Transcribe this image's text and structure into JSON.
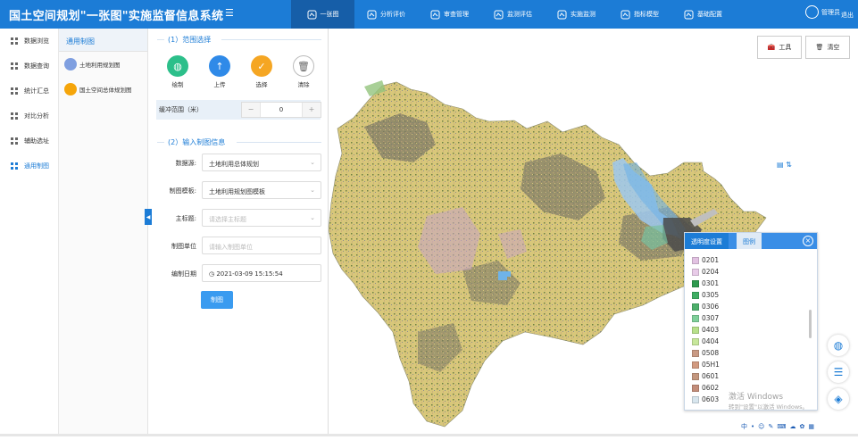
{
  "app": {
    "title": "国土空间规划\"一张图\"实施监督信息系统",
    "menu_icon": "menu-toggle-icon"
  },
  "topnav": [
    {
      "label": "一张图",
      "icon": "map-icon",
      "active": true
    },
    {
      "label": "分析评价",
      "icon": "pie-chart-icon"
    },
    {
      "label": "审查管理",
      "icon": "review-icon"
    },
    {
      "label": "监测评估",
      "icon": "monitor-icon"
    },
    {
      "label": "实施监测",
      "icon": "checklist-icon"
    },
    {
      "label": "指标模型",
      "icon": "cloud-icon"
    },
    {
      "label": "基础配置",
      "icon": "gear-icon"
    }
  ],
  "user": {
    "name": "管理员",
    "logout": "退出"
  },
  "leftnav": [
    {
      "label": "数据浏览"
    },
    {
      "label": "数据查询"
    },
    {
      "label": "统计汇总"
    },
    {
      "label": "对比分析"
    },
    {
      "label": "辅助选址"
    },
    {
      "label": "通用制图",
      "active": true
    }
  ],
  "subnav": {
    "header": "通用制图",
    "items": [
      {
        "label": "土地利用规划图",
        "color": "#7f9fe0"
      },
      {
        "label": "国土空间总体规划图",
        "color": "#f5a50a"
      }
    ],
    "collapse": "◀"
  },
  "panel": {
    "section1": "(1）范围选择",
    "tools": [
      {
        "label": "绘制",
        "color": "#2cbf8a",
        "glyph": "◍"
      },
      {
        "label": "上传",
        "color": "#2f8ae8",
        "glyph": "↑"
      },
      {
        "label": "选择",
        "color": "#f5a623",
        "glyph": "✓"
      },
      {
        "label": "清除",
        "color": "#ffffff",
        "glyph": "🗑"
      }
    ],
    "buffer": {
      "label": "缓冲范围（米）",
      "value": "0",
      "minus": "−",
      "plus": "+"
    },
    "section2": "(2）输入制图信息",
    "fields": [
      {
        "label": "数据源:",
        "value": "土地利用总体规划",
        "placeholder": false,
        "dropdown": true
      },
      {
        "label": "制图模板:",
        "value": "土地利用规划图模板",
        "placeholder": false,
        "dropdown": true
      },
      {
        "label": "主标题:",
        "value": "请选择主标题",
        "placeholder": true,
        "dropdown": true
      },
      {
        "label": "制图单位",
        "value": "请输入制图单位",
        "placeholder": true,
        "dropdown": false
      },
      {
        "label": "编制日期",
        "value": "2021-03-09 15:15:54",
        "placeholder": false,
        "dropdown": false
      }
    ],
    "submit": "制图"
  },
  "map": {
    "tools": [
      {
        "label": "工具"
      },
      {
        "label": "清空"
      }
    ],
    "layer_icon": "▤ ⇅"
  },
  "legend": {
    "tabs": [
      "透明度设置",
      "图例"
    ],
    "items": [
      {
        "code": "0201",
        "color": "#e2c2e2"
      },
      {
        "code": "0204",
        "color": "#e8cbe8"
      },
      {
        "code": "0301",
        "color": "#2e9a4e"
      },
      {
        "code": "0305",
        "color": "#3fae63"
      },
      {
        "code": "0306",
        "color": "#4caf6a"
      },
      {
        "code": "0307",
        "color": "#7fd09a"
      },
      {
        "code": "0403",
        "color": "#b7e08a"
      },
      {
        "code": "0404",
        "color": "#c7e79b"
      },
      {
        "code": "0508",
        "color": "#c99a84"
      },
      {
        "code": "05H1",
        "color": "#d29a80"
      },
      {
        "code": "0601",
        "color": "#c4977e"
      },
      {
        "code": "0602",
        "color": "#c38d79"
      },
      {
        "code": "0603",
        "color": "#d8e6ee"
      }
    ]
  },
  "watermark": {
    "line1": "激活 Windows",
    "line2": "转到\"设置\"以激活 Windows。"
  },
  "float_buttons": [
    "globe-icon",
    "list-icon",
    "layers-icon"
  ],
  "ime": [
    "中",
    "•",
    "☺",
    "✎",
    "⌨",
    "☁",
    "✿",
    "▦"
  ]
}
